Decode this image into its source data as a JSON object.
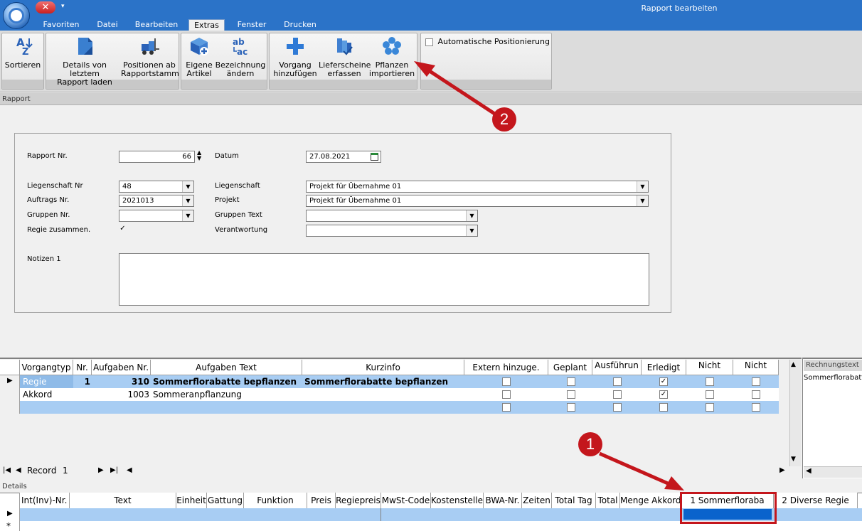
{
  "window": {
    "title": "Rapport bearbeiten"
  },
  "menu": {
    "tabs": [
      {
        "label": "Favoriten"
      },
      {
        "label": "Datei"
      },
      {
        "label": "Bearbeiten"
      },
      {
        "label": "Extras",
        "active": true
      },
      {
        "label": "Fenster"
      },
      {
        "label": "Drucken"
      }
    ]
  },
  "ribbon": {
    "sortieren": "Sortieren",
    "details_l1": "Details von letztem",
    "details_l2": "Rapport laden",
    "positionen_l1": "Positionen ab",
    "positionen_l2": "Rapportstamm",
    "eigene_l1": "Eigene",
    "eigene_l2": "Artikel",
    "bezeichnung_l1": "Bezeichnung",
    "bezeichnung_l2": "ändern",
    "vorgang_l1": "Vorgang",
    "vorgang_l2": "hinzufügen",
    "lieferscheine_l1": "Lieferscheine",
    "lieferscheine_l2": "erfassen",
    "pflanzen_l1": "Pflanzen",
    "pflanzen_l2": "importieren",
    "auto_pos": "Automatische Positionierung"
  },
  "section": {
    "rapport": "Rapport",
    "details": "Details"
  },
  "form": {
    "rapport_nr_label": "Rapport Nr.",
    "rapport_nr": "66",
    "datum_label": "Datum",
    "datum": "27.08.2021",
    "liegenschaft_nr_label": "Liegenschaft Nr",
    "liegenschaft_nr": "48",
    "liegenschaft_label": "Liegenschaft",
    "liegenschaft": "Projekt für Übernahme 01",
    "auftrags_nr_label": "Auftrags Nr.",
    "auftrags_nr": "2021013",
    "projekt_label": "Projekt",
    "projekt": "Projekt für Übernahme 01",
    "gruppen_nr_label": "Gruppen Nr.",
    "gruppen_nr": "",
    "gruppen_text_label": "Gruppen Text",
    "gruppen_text": "",
    "regie_label": "Regie zusammen.",
    "verantwortung_label": "Verantwortung",
    "verantwortung": "",
    "notizen_label": "Notizen 1",
    "notizen": ""
  },
  "grid": {
    "headers": {
      "vorgangtyp": "Vorgangtyp",
      "nr": "Nr.",
      "aufgaben_nr": "Aufgaben Nr.",
      "aufgaben_text": "Aufgaben Text",
      "kurzinfo": "Kurzinfo",
      "extern": "Extern hinzuge.",
      "geplant": "Geplant",
      "ausfuehrung": "Ausführun",
      "erledigt": "Erledigt",
      "nicht1": "Nicht",
      "nicht2": "Nicht"
    },
    "rows": [
      {
        "vorgangtyp": "Regie",
        "nr": "1",
        "aufgaben_nr": "310",
        "aufgaben_text": "Sommerflorabatte bepflanzen",
        "kurzinfo": "Sommerflorabatte bepflanzen"
      },
      {
        "vorgangtyp": "Akkord",
        "nr": "",
        "aufgaben_nr": "1003",
        "aufgaben_text": "Sommeranpflanzung",
        "kurzinfo": ""
      }
    ],
    "record_label": "Record",
    "record_value": "1"
  },
  "right_panel": {
    "header": "Rechnungstext",
    "value": "Sommerflorabatt"
  },
  "details_grid": {
    "headers": {
      "int_nr": "Int(Inv)-Nr.",
      "text": "Text",
      "einheit": "Einheit",
      "gattung": "Gattung",
      "funktion": "Funktion",
      "preis": "Preis",
      "regiepreis": "Regiepreis",
      "mwst": "MwSt-Code",
      "kostenstelle": "Kostenstelle",
      "bwa": "BWA-Nr.",
      "zeiten": "Zeiten",
      "total_tag": "Total Tag",
      "total": "Total",
      "menge": "Menge Akkord",
      "sommerflora": "1 Sommerfloraba",
      "diverse": "2 Diverse Regie"
    }
  },
  "annotations": {
    "badge1": "1",
    "badge2": "2"
  },
  "colors": {
    "accent": "#2b73c8",
    "row_selected": "#a8cdf3",
    "annotation": "#c4161c"
  }
}
